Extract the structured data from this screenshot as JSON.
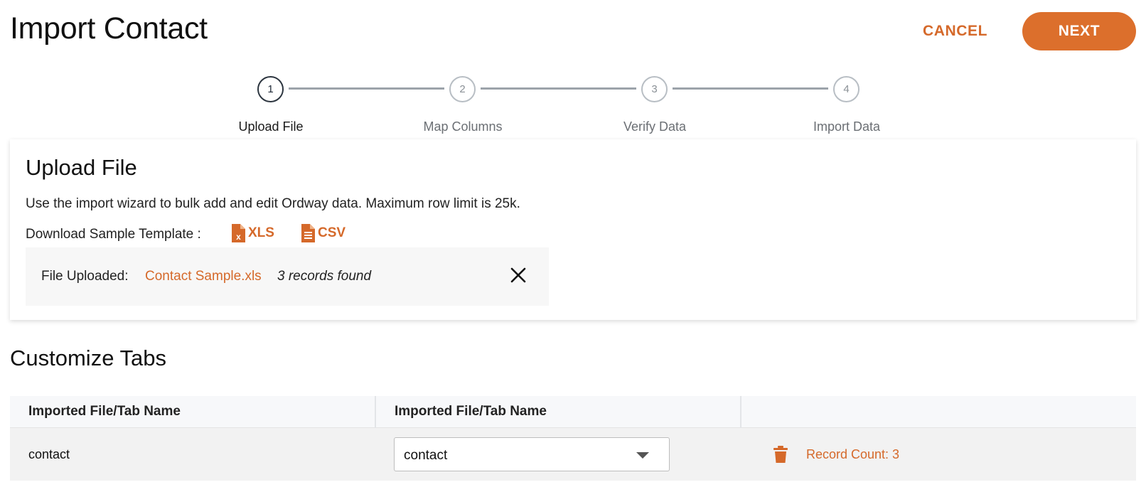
{
  "header": {
    "title": "Import Contact",
    "cancel_label": "CANCEL",
    "next_label": "NEXT"
  },
  "stepper": {
    "steps": [
      {
        "number": "1",
        "label": "Upload File",
        "active": true
      },
      {
        "number": "2",
        "label": "Map Columns",
        "active": false
      },
      {
        "number": "3",
        "label": "Verify Data",
        "active": false
      },
      {
        "number": "4",
        "label": "Import Data",
        "active": false
      }
    ]
  },
  "upload": {
    "title": "Upload File",
    "description": "Use the import wizard to bulk add and edit Ordway data. Maximum row limit is 25k.",
    "template_label": "Download Sample Template :",
    "xls_label": "XLS",
    "csv_label": "CSV",
    "file_uploaded_label": "File Uploaded:",
    "file_name": "Contact Sample.xls",
    "records_found": "3 records found"
  },
  "customize": {
    "title": "Customize Tabs",
    "columns": [
      "Imported File/Tab Name",
      "Imported File/Tab Name",
      ""
    ],
    "rows": [
      {
        "tab_name": "contact",
        "selected": "contact",
        "record_count": "Record Count: 3"
      }
    ]
  },
  "colors": {
    "accent": "#DC6F2C",
    "link": "#D5692A"
  },
  "icons": [
    "xls-file-icon",
    "csv-file-icon",
    "close-icon",
    "chevron-down-icon",
    "trash-icon"
  ]
}
